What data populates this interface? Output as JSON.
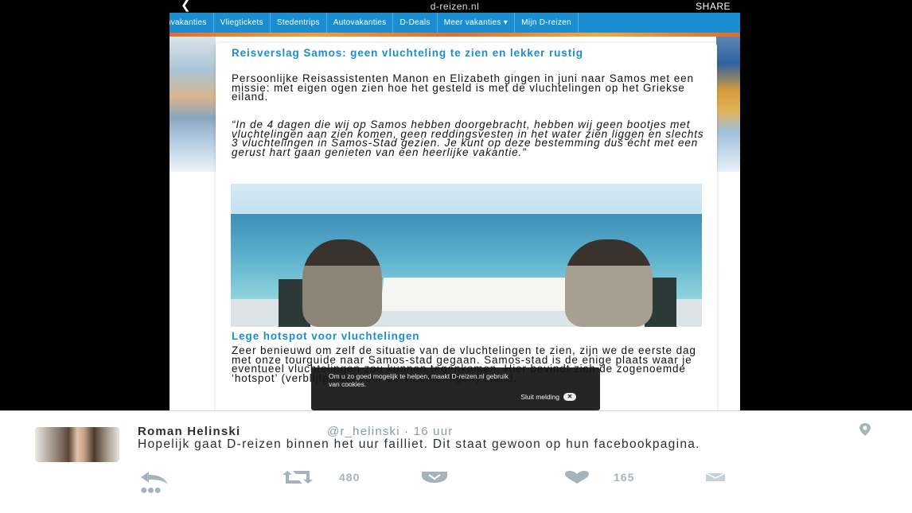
{
  "browser": {
    "page_title": "d-reizen.nl",
    "share_label": "SHARE",
    "back_icon": "chevron-left-icon"
  },
  "nav": {
    "items": [
      "onvakanties",
      "Vliegtickets",
      "Stedentrips",
      "Autovakanties",
      "D-Deals",
      "Meer vakanties ▾",
      "Mijn D-reizen"
    ]
  },
  "article": {
    "title": "Reisverslag Samos: geen vluchteling te zien en lekker rustig",
    "intro": "Persoonlijke Reisassistenten Manon en Elizabeth gingen in juni naar Samos met een missie: met eigen ogen zien hoe het gesteld is met de vluchtelingen op het Griekse eiland.",
    "quote": "“In de 4 dagen die wij op Samos hebben doorgebracht, hebben wij geen bootjes met vluchtelingen aan zien komen, geen reddingsvesten in het water zien liggen en slechts 3 vluchtelingen in Samos-Stad gezien. Je kunt op deze bestemming dus écht met een gerust hart gaan genieten van een heerlijke vakantie.”",
    "subheading": "Lege hotspot voor vluchtelingen",
    "body": "Zeer benieuwd om zelf de situatie van de vluchtelingen te zien, zijn we de eerste dag met onze tourguide naar Samos-stad gegaan. Samos-stad is de enige plaats waar je eventueel vluchtelingen zou kunnen tegenkomen. Hier bevindt zich de zogenoemde ‘hotspot’ (verblijfplaats voor de vluchtelingen) stand."
  },
  "cookie_banner": {
    "text": "Om u zo goed mogelijk te helpen, maakt D-reizen.nl gebruik van cookies.",
    "close_label": "Sluit melding",
    "close_icon": "close-icon"
  },
  "tweet": {
    "author_name": "Roman Helinski",
    "handle_time": "@r_helinski · 16 uur",
    "text": "Hopelijk gaat D-reizen binnen het uur failliet. Dit staat gewoon op hun facebookpagina.",
    "retweet_count": "480",
    "like_count": "165",
    "icons": [
      "reply-icon",
      "retweet-icon",
      "pocket-icon",
      "heart-icon",
      "mail-icon",
      "more-icon",
      "location-pin-icon"
    ],
    "colors": {
      "action_gray": "#a5b3bd",
      "handle_gray": "#8899a6",
      "link_blue": "#1a8ed0"
    }
  }
}
